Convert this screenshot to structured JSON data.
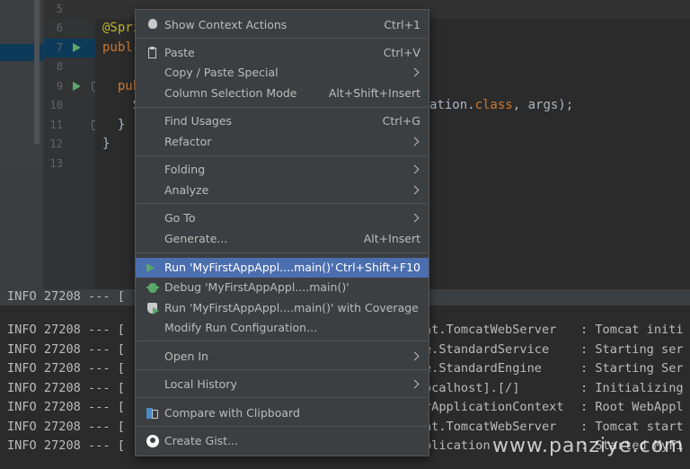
{
  "editor": {
    "line_numbers": [
      "5",
      "6",
      "7",
      "8",
      "9",
      "10",
      "11",
      "12",
      "13"
    ],
    "code_lines": [
      {
        "parts": [
          {
            "t": "",
            "c": "plain"
          }
        ]
      },
      {
        "parts": [
          {
            "t": "@Spri",
            "c": "ann"
          }
        ]
      },
      {
        "parts": [
          {
            "t": "publ",
            "c": "kw"
          }
        ]
      },
      {
        "parts": [
          {
            "t": "",
            "c": "plain"
          }
        ]
      },
      {
        "parts": [
          {
            "t": "  pub",
            "c": "kw"
          }
        ]
      },
      {
        "parts": [
          {
            "t": "    S",
            "c": "plain"
          }
        ]
      },
      {
        "parts": [
          {
            "t": "  }",
            "c": "plain"
          }
        ]
      },
      {
        "parts": [
          {
            "t": "}",
            "c": "plain"
          }
        ]
      },
      {
        "parts": [
          {
            "t": "",
            "c": "plain"
          }
        ]
      }
    ],
    "line10_tail": {
      "prefix": "ation.",
      "kw": "class",
      "suffix": ", args);"
    }
  },
  "console": {
    "rows": [
      {
        "prefix": "INFO 27208 --- [",
        "middle": "",
        "right": ""
      },
      {
        "prefix": "INFO 27208 --- [",
        "middle": "at.TomcatWebServer",
        "right": ": Tomcat initi"
      },
      {
        "prefix": "INFO 27208 --- [",
        "middle": "e.StandardService",
        "right": ": Starting ser"
      },
      {
        "prefix": "INFO 27208 --- [",
        "middle": "e.StandardEngine",
        "right": ": Starting Ser"
      },
      {
        "prefix": "INFO 27208 --- [",
        "middle": "ocalhost].[/]",
        "right": ": Initializing"
      },
      {
        "prefix": "INFO 27208 --- [",
        "middle": "rApplicationContext",
        "right": ": Root WebAppl"
      },
      {
        "prefix": "INFO 27208 --- [",
        "middle": "at.TomcatWebServer",
        "right": ": Tomcat start"
      },
      {
        "prefix": "INFO 27208 --- [",
        "middle": "plication",
        "right": ": Started MyFi"
      }
    ]
  },
  "menu": {
    "items": [
      {
        "label": "Show Context Actions",
        "shortcut": "Ctrl+1",
        "icon": "lightbulb-icon",
        "submenu": false
      },
      {
        "label": "Paste",
        "shortcut": "Ctrl+V",
        "icon": "paste-icon",
        "submenu": false
      },
      {
        "label": "Copy / Paste Special",
        "shortcut": "",
        "icon": "",
        "submenu": true
      },
      {
        "label": "Column Selection Mode",
        "shortcut": "Alt+Shift+Insert",
        "icon": "",
        "submenu": false
      },
      {
        "label": "Find Usages",
        "shortcut": "Ctrl+G",
        "icon": "",
        "submenu": false
      },
      {
        "label": "Refactor",
        "shortcut": "",
        "icon": "",
        "submenu": true
      },
      {
        "label": "Folding",
        "shortcut": "",
        "icon": "",
        "submenu": true
      },
      {
        "label": "Analyze",
        "shortcut": "",
        "icon": "",
        "submenu": true
      },
      {
        "label": "Go To",
        "shortcut": "",
        "icon": "",
        "submenu": true
      },
      {
        "label": "Generate...",
        "shortcut": "Alt+Insert",
        "icon": "",
        "submenu": false
      },
      {
        "label": "Run 'MyFirstAppAppl....main()'",
        "shortcut": "Ctrl+Shift+F10",
        "icon": "run-icon",
        "submenu": false,
        "highlighted": true
      },
      {
        "label": "Debug 'MyFirstAppAppl....main()'",
        "shortcut": "",
        "icon": "debug-icon",
        "submenu": false
      },
      {
        "label": "Run 'MyFirstAppAppl....main()' with Coverage",
        "shortcut": "",
        "icon": "coverage-icon",
        "submenu": false
      },
      {
        "label": "Modify Run Configuration...",
        "shortcut": "",
        "icon": "",
        "submenu": false
      },
      {
        "label": "Open In",
        "shortcut": "",
        "icon": "",
        "submenu": true
      },
      {
        "label": "Local History",
        "shortcut": "",
        "icon": "",
        "submenu": true
      },
      {
        "label": "Compare with Clipboard",
        "shortcut": "",
        "icon": "compare-icon",
        "submenu": false
      },
      {
        "label": "Create Gist...",
        "shortcut": "",
        "icon": "github-icon",
        "submenu": false
      }
    ]
  },
  "watermark": "www.panziye.com",
  "colors": {
    "highlight": "#4b6eaf",
    "menu_bg": "#3c3f41",
    "editor_bg": "#2b2b2b",
    "run_green": "#59a869"
  }
}
